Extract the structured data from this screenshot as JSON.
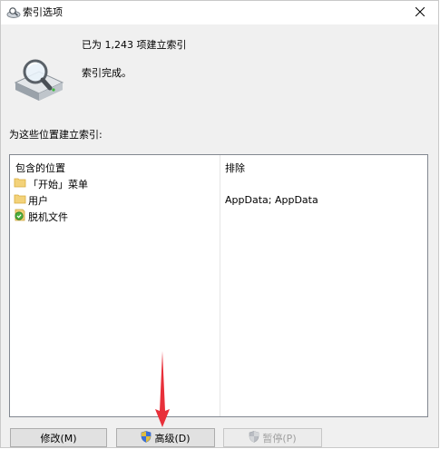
{
  "window": {
    "title": "索引选项",
    "icons": {
      "title": "indexing-options-icon",
      "close": "close-icon",
      "status": "disk-magnifier-icon"
    }
  },
  "status": {
    "count_text": "已为 1,243 项建立索引",
    "state_text": "索引完成。"
  },
  "locations": {
    "section_label": "为这些位置建立索引:",
    "columns": {
      "included": "包含的位置",
      "excluded": "排除"
    },
    "rows": [
      {
        "name": "「开始」菜单",
        "excluded": "",
        "icon": "folder-icon"
      },
      {
        "name": "用户",
        "excluded": "AppData; AppData",
        "icon": "folder-icon"
      },
      {
        "name": "脱机文件",
        "excluded": "",
        "icon": "offline-files-icon"
      }
    ]
  },
  "buttons": {
    "modify": "修改(M)",
    "advanced": "高级(D)",
    "pause": "暂停(P)",
    "shield_icon": "uac-shield-icon"
  },
  "colors": {
    "annotation_arrow": "#e8303a"
  }
}
